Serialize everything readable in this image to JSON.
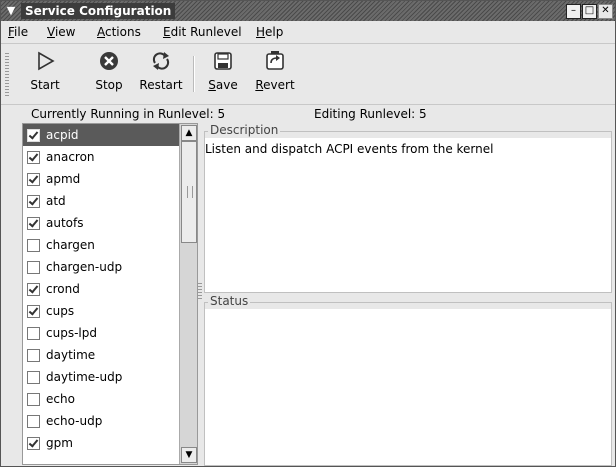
{
  "window": {
    "title": "Service Configuration"
  },
  "menubar": [
    {
      "u": "F",
      "rest": "ile"
    },
    {
      "u": "V",
      "rest": "iew"
    },
    {
      "u": "A",
      "rest": "ctions"
    },
    {
      "u": "E",
      "rest": "dit Runlevel"
    },
    {
      "u": "H",
      "rest": "elp"
    }
  ],
  "toolbar": {
    "start": "Start",
    "stop": "Stop",
    "restart": "Restart",
    "save_u": "S",
    "save_rest": "ave",
    "revert_u": "R",
    "revert_rest": "evert"
  },
  "status_row": {
    "running": "Currently Running in Runlevel: 5",
    "editing": "Editing Runlevel: 5"
  },
  "services": [
    {
      "name": "acpid",
      "checked": true,
      "selected": true
    },
    {
      "name": "anacron",
      "checked": true
    },
    {
      "name": "apmd",
      "checked": true
    },
    {
      "name": "atd",
      "checked": true
    },
    {
      "name": "autofs",
      "checked": true
    },
    {
      "name": "chargen",
      "checked": false
    },
    {
      "name": "chargen-udp",
      "checked": false
    },
    {
      "name": "crond",
      "checked": true
    },
    {
      "name": "cups",
      "checked": true
    },
    {
      "name": "cups-lpd",
      "checked": false
    },
    {
      "name": "daytime",
      "checked": false
    },
    {
      "name": "daytime-udp",
      "checked": false
    },
    {
      "name": "echo",
      "checked": false
    },
    {
      "name": "echo-udp",
      "checked": false
    },
    {
      "name": "gpm",
      "checked": true
    }
  ],
  "description": {
    "label": "Description",
    "text": "Listen and dispatch ACPI events from the kernel"
  },
  "status": {
    "label": "Status",
    "text": ""
  }
}
